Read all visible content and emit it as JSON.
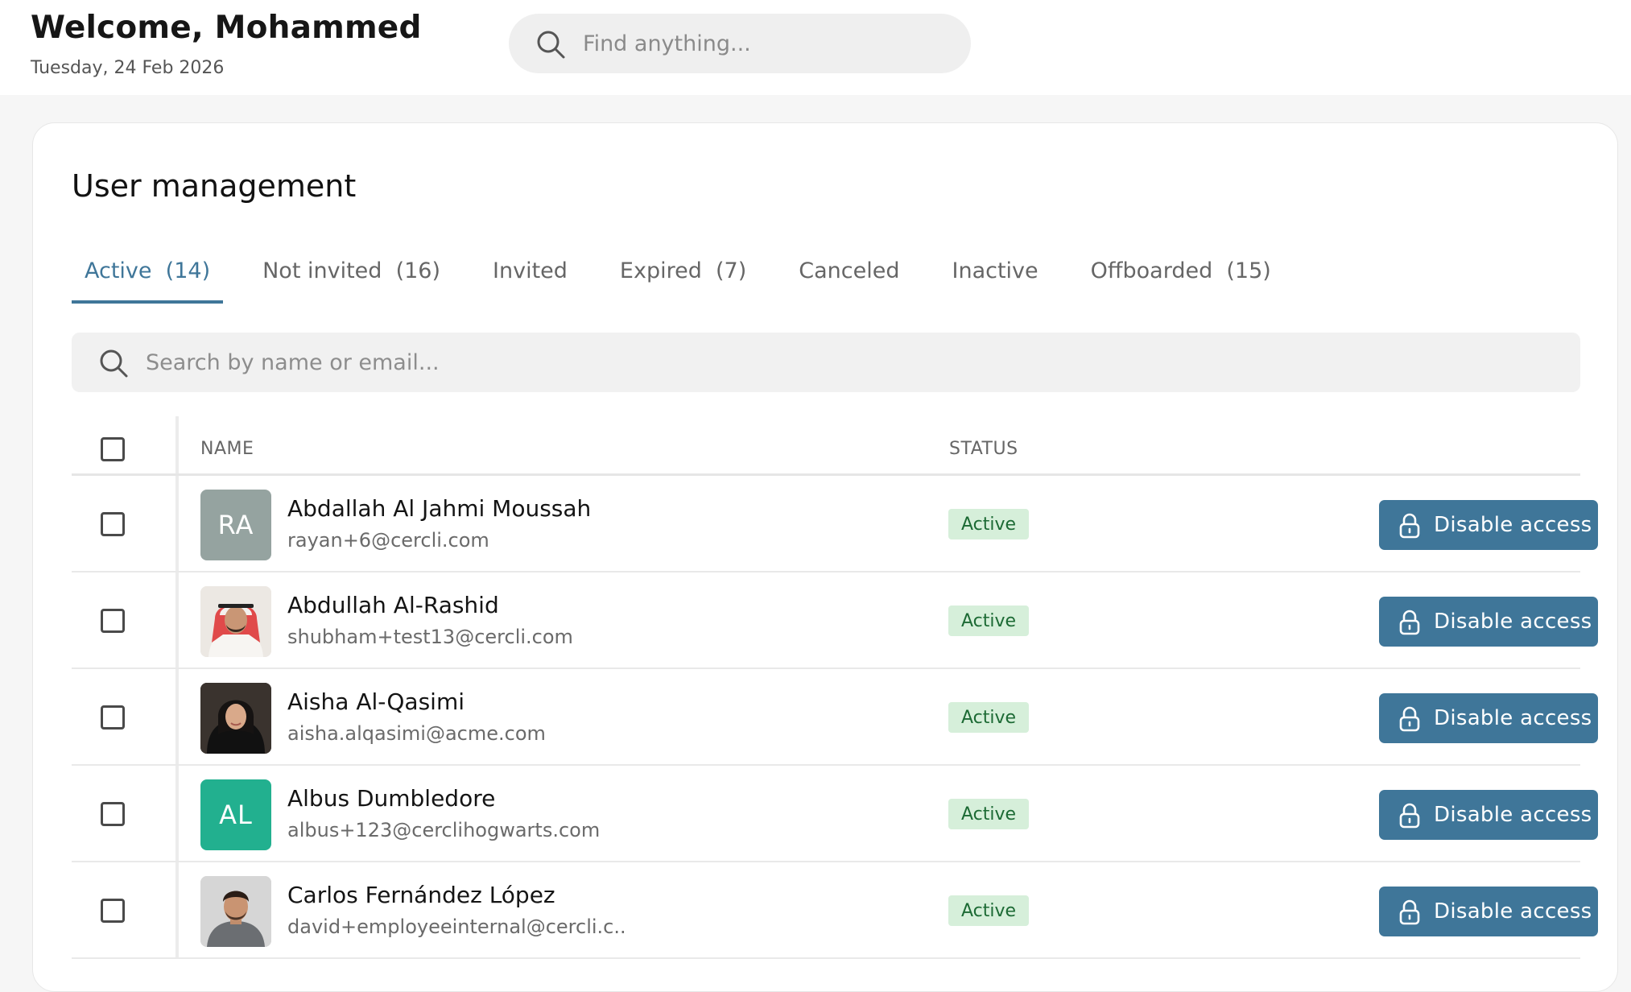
{
  "header": {
    "welcome": "Welcome, Mohammed",
    "date": "Tuesday, 24 Feb 2026",
    "search_placeholder": "Find anything..."
  },
  "page": {
    "title": "User management"
  },
  "tabs": [
    {
      "label": "Active  (14)",
      "active": true
    },
    {
      "label": "Not invited  (16)",
      "active": false
    },
    {
      "label": "Invited",
      "active": false
    },
    {
      "label": "Expired  (7)",
      "active": false
    },
    {
      "label": "Canceled",
      "active": false
    },
    {
      "label": "Inactive",
      "active": false
    },
    {
      "label": "Offboarded  (15)",
      "active": false
    }
  ],
  "table_search": {
    "placeholder": "Search by name or email..."
  },
  "table": {
    "headers": {
      "name": "NAME",
      "status": "STATUS"
    },
    "action_label": "Disable access",
    "rows": [
      {
        "initials": "RA",
        "avatar_color": "#95a3a0",
        "photo": false,
        "name": "Abdallah Al Jahmi Moussah",
        "email": "rayan+6@cercli.com",
        "status": "Active"
      },
      {
        "initials": "",
        "avatar_color": "#e9e4df",
        "photo": true,
        "name": "Abdullah Al-Rashid",
        "email": "shubham+test13@cercli.com",
        "status": "Active"
      },
      {
        "initials": "",
        "avatar_color": "#2c2622",
        "photo": true,
        "name": "Aisha Al-Qasimi",
        "email": "aisha.alqasimi@acme.com",
        "status": "Active"
      },
      {
        "initials": "AL",
        "avatar_color": "#22b08f",
        "photo": false,
        "name": "Albus Dumbledore",
        "email": "albus+123@cerclihogwarts.com",
        "status": "Active"
      },
      {
        "initials": "",
        "avatar_color": "#d9d9d9",
        "photo": true,
        "name": "Carlos Fernández López",
        "email": "david+employeeinternal@cercli.c...",
        "status": "Active"
      }
    ]
  },
  "colors": {
    "accent": "#3f7699",
    "badge_bg": "#d6efda",
    "badge_text": "#1c6a34"
  }
}
